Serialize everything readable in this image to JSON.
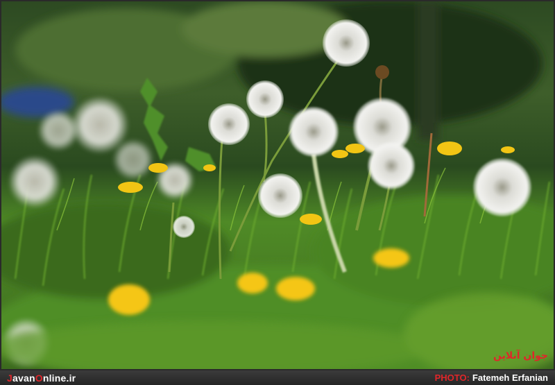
{
  "photo": {
    "subject": "dandelion-meadow",
    "colors": {
      "background_dark": "#1f3a1c",
      "grass_green": "#5f9a2a",
      "seed_head_white": "#e9e9e9",
      "flower_yellow": "#f2c514",
      "accent_red": "#e0262a"
    }
  },
  "caption_bar": {
    "site_prefix": "J",
    "site_middle": "avan",
    "site_accent": "O",
    "site_suffix": "nline.ir",
    "credit_label": "PHOTO:",
    "credit_name": "Fatemeh Erfanian"
  },
  "watermark": {
    "text": "جوان آنلاین"
  }
}
